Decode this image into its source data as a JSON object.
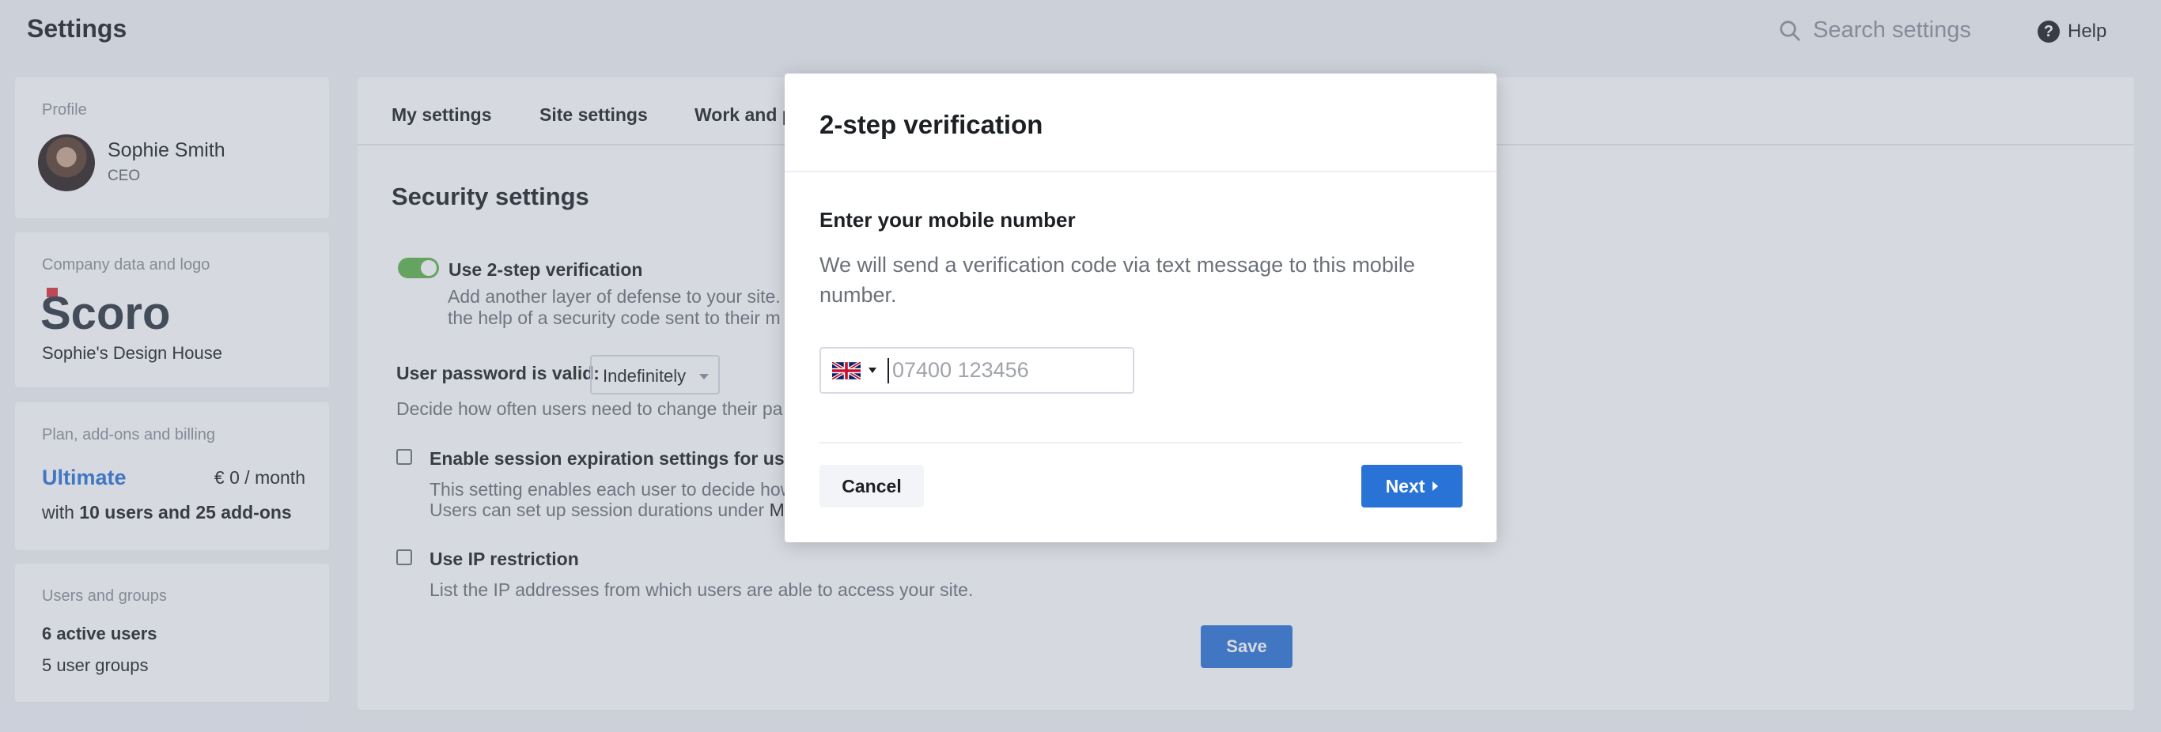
{
  "app": {
    "title": "Settings"
  },
  "header": {
    "search_placeholder": "Search settings",
    "help_label": "Help",
    "help_icon_glyph": "?"
  },
  "sidebar": {
    "profile": {
      "label": "Profile",
      "name": "Sophie Smith",
      "role": "CEO"
    },
    "company": {
      "label": "Company data and logo",
      "logo_text": "Scoro",
      "name": "Sophie's Design House"
    },
    "plan": {
      "label": "Plan, add-ons and billing",
      "name": "Ultimate",
      "price": "€ 0 / month",
      "desc_prefix": "with ",
      "desc_bold": "10 users and 25 add-ons"
    },
    "users": {
      "label": "Users and groups",
      "active": "6 active users",
      "groups": "5 user groups"
    }
  },
  "main": {
    "tabs": [
      {
        "label": "My settings"
      },
      {
        "label": "Site settings"
      },
      {
        "label": "Work and p"
      }
    ],
    "section_title": "Security settings",
    "two_step": {
      "title": "Use 2-step verification",
      "desc_line1": "Add another layer of defense to your site.",
      "desc_line2": "the help of a security code sent to their m",
      "enabled": true
    },
    "password": {
      "label": "User password is valid:",
      "value": "Indefinitely",
      "desc": "Decide how often users need to change their pa"
    },
    "session": {
      "title": "Enable session expiration settings for users",
      "desc_line1": "This setting enables each user to decide how",
      "desc_line2_prefix": "Users can set up session durations under ",
      "desc_line2_link": "My"
    },
    "ip": {
      "title": "Use IP restriction",
      "desc": "List the IP addresses from which users are able to access your site."
    },
    "save_label": "Save"
  },
  "modal": {
    "title": "2-step verification",
    "heading": "Enter your mobile number",
    "description": "We will send a verification code via text message to this mobile number.",
    "phone_placeholder": "07400 123456",
    "country_flag": "uk-flag-icon",
    "cancel_label": "Cancel",
    "next_label": "Next"
  },
  "colors": {
    "accent": "#2a73d6",
    "toggle_on": "#5db24a",
    "logo_red": "#d9323b"
  }
}
